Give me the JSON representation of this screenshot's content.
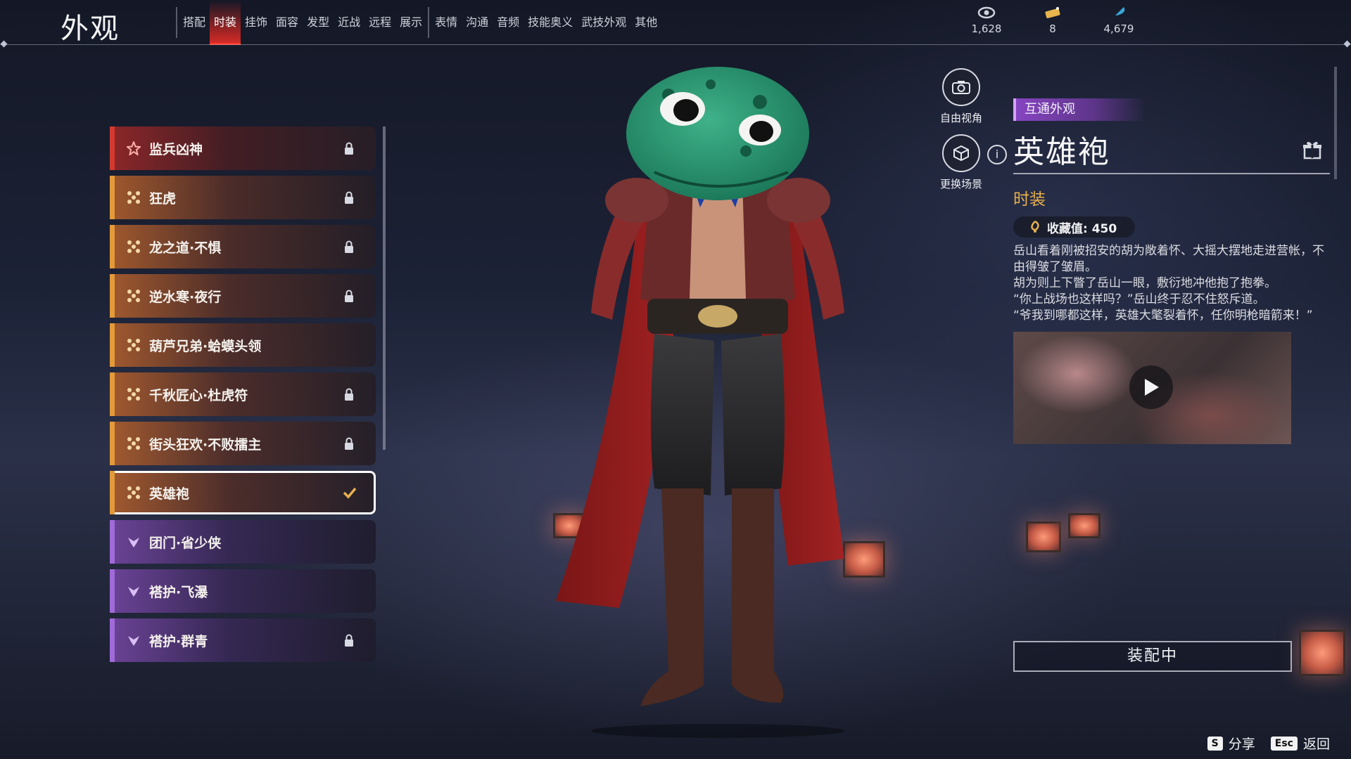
{
  "header": {
    "title": "外观",
    "tabs": [
      "搭配",
      "时装",
      "挂饰",
      "面容",
      "发型",
      "近战",
      "远程",
      "展示",
      "表情",
      "沟通",
      "音频",
      "技能奥义",
      "武技外观",
      "其他"
    ],
    "active_tab": "时装",
    "currencies": [
      {
        "icon": "currency-eye-icon",
        "value": "1,628"
      },
      {
        "icon": "ticket-icon",
        "value": "8"
      },
      {
        "icon": "feather-icon",
        "value": "4,679"
      }
    ]
  },
  "outfits": [
    {
      "label": "监兵凶神",
      "rarity": "red",
      "locked": true,
      "selected": false
    },
    {
      "label": "狂虎",
      "rarity": "orange",
      "locked": true,
      "selected": false
    },
    {
      "label": "龙之道·不惧",
      "rarity": "orange",
      "locked": true,
      "selected": false
    },
    {
      "label": "逆水寒·夜行",
      "rarity": "orange",
      "locked": true,
      "selected": false
    },
    {
      "label": "葫芦兄弟·蛤蟆头领",
      "rarity": "orange",
      "locked": false,
      "selected": false
    },
    {
      "label": "千秋匠心·杜虎符",
      "rarity": "orange",
      "locked": true,
      "selected": false
    },
    {
      "label": "街头狂欢·不败擂主",
      "rarity": "orange",
      "locked": true,
      "selected": false
    },
    {
      "label": "英雄袍",
      "rarity": "orange",
      "locked": false,
      "selected": true
    },
    {
      "label": "团门·省少侠",
      "rarity": "purple",
      "locked": false,
      "selected": false
    },
    {
      "label": "褡护·飞瀑",
      "rarity": "purple",
      "locked": false,
      "selected": false
    },
    {
      "label": "褡护·群青",
      "rarity": "purple",
      "locked": true,
      "selected": false
    }
  ],
  "side_buttons": {
    "free_view": "自由视角",
    "change_scene": "更换场景"
  },
  "detail": {
    "tag": "互通外观",
    "name": "英雄袍",
    "category": "时装",
    "collect_label": "收藏值: 450",
    "description": "岳山看着刚被招安的胡为敞着怀、大摇大摆地走进营帐，不由得皱了皱眉。\n胡为则上下瞥了岳山一眼，敷衍地冲他抱了抱拳。\n“你上战场也这样吗？”岳山终于忍不住怒斥道。\n“爷我到哪都这样，英雄大氅裂着怀，任你明枪暗箭来！”",
    "equip_button": "装配中"
  },
  "footer": {
    "share_key": "S",
    "share_label": "分享",
    "back_key": "Esc",
    "back_label": "返回"
  },
  "colors": {
    "accent_red": "#ff3a2e",
    "rarity_red": "#d23a2e",
    "rarity_orange": "#e39a3a",
    "rarity_purple": "#a06ad8",
    "category_gold": "#e7b04e"
  }
}
